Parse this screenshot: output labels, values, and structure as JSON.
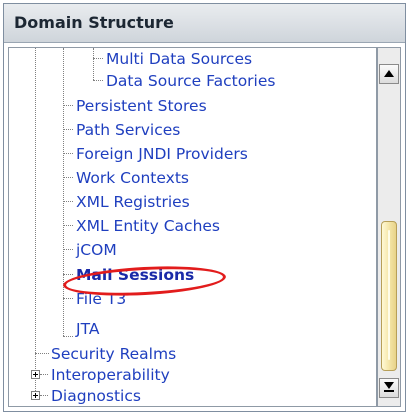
{
  "panel": {
    "title": "Domain Structure"
  },
  "tree": {
    "items": [
      {
        "label": "Multi Data Sources",
        "bold": false
      },
      {
        "label": "Data Source Factories",
        "bold": false
      },
      {
        "label": "Persistent Stores",
        "bold": false
      },
      {
        "label": "Path Services",
        "bold": false
      },
      {
        "label": "Foreign JNDI Providers",
        "bold": false
      },
      {
        "label": "Work Contexts",
        "bold": false
      },
      {
        "label": "XML Registries",
        "bold": false
      },
      {
        "label": "XML Entity Caches",
        "bold": false
      },
      {
        "label": "jCOM",
        "bold": false
      },
      {
        "label": "Mail Sessions",
        "bold": true
      },
      {
        "label": "File T3",
        "bold": false
      },
      {
        "label": "JTA",
        "bold": false
      },
      {
        "label": "Security Realms",
        "bold": false
      },
      {
        "label": "Interoperability",
        "bold": false
      },
      {
        "label": "Diagnostics",
        "bold": false
      }
    ]
  },
  "colors": {
    "link": "#1f3fbf",
    "highlight": "#e21c1c",
    "scroll_thumb": "#f5e6a8"
  },
  "icons": {
    "expand": "plus-expander-icon",
    "scroll_up": "arrow-up-icon",
    "scroll_down": "arrow-down-icon"
  }
}
